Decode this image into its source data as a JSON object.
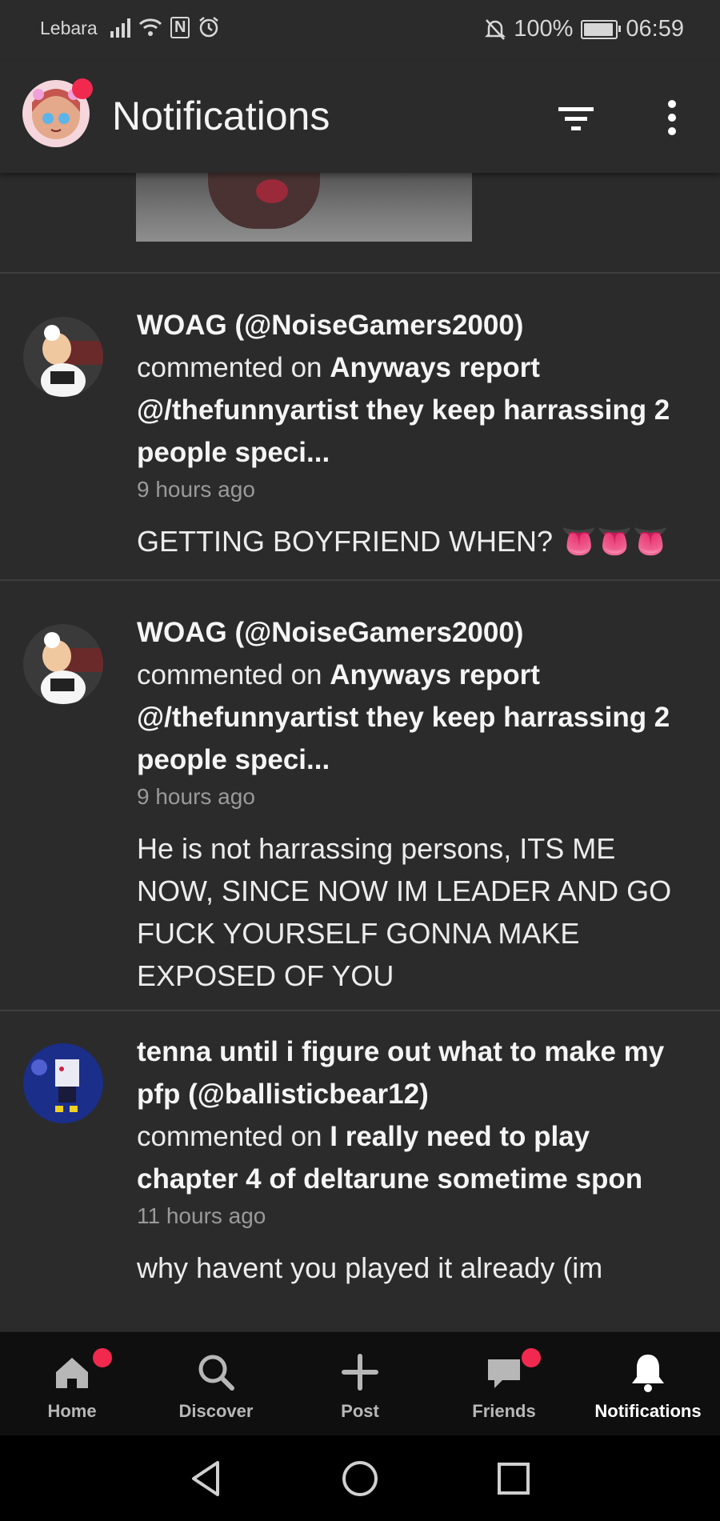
{
  "status_bar": {
    "carrier": "Lebara",
    "nfc": "N",
    "battery": "100%",
    "time": "06:59",
    "icons": [
      "signal-icon",
      "wifi-icon",
      "nfc-icon",
      "alarm-icon",
      "mute-icon",
      "battery-icon"
    ]
  },
  "header": {
    "title": "Notifications"
  },
  "notifications": [
    {
      "user": "WOAG (@NoiseGamers2000)",
      "action": "commented on",
      "post": "Anyways report @/thefunnyartist they keep harrassing 2 people speci...",
      "time": "9 hours ago",
      "comment": "GETTING BOYFRIEND WHEN? 👅👅👅"
    },
    {
      "user": "WOAG (@NoiseGamers2000)",
      "action": "commented on",
      "post": "Anyways report @/thefunnyartist they keep harrassing 2 people speci...",
      "time": "9 hours ago",
      "comment": "He is not harrassing persons, ITS ME NOW, SINCE NOW IM LEADER AND GO FUCK YOURSELF GONNA MAKE EXPOSED OF YOU"
    },
    {
      "user": "tenna until i figure out what to make my pfp (@ballisticbear12)",
      "action": "commented on",
      "post": "I really need to play chapter 4 of deltarune sometime spon",
      "time": "11 hours ago",
      "comment": "why havent you played it already (im"
    }
  ],
  "bottom_nav": [
    {
      "label": "Home",
      "icon": "home-icon",
      "badge": true
    },
    {
      "label": "Discover",
      "icon": "search-icon",
      "badge": false
    },
    {
      "label": "Post",
      "icon": "plus-icon",
      "badge": false
    },
    {
      "label": "Friends",
      "icon": "chat-icon",
      "badge": true
    },
    {
      "label": "Notifications",
      "icon": "bell-icon",
      "badge": false,
      "active": true
    }
  ],
  "colors": {
    "background": "#2b2b2b",
    "badge": "#f1294f",
    "nav_background": "#0f0f0f"
  }
}
